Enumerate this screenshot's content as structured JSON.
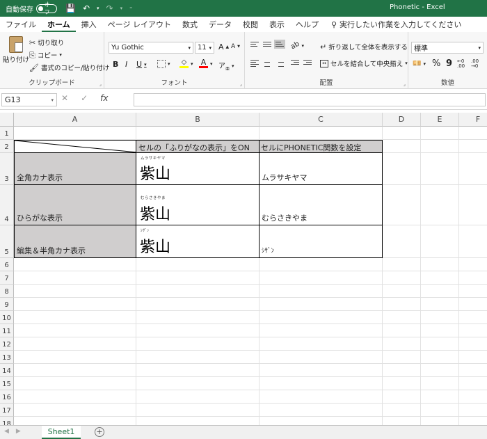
{
  "titlebar": {
    "autosave_label": "自動保存",
    "autosave_state": "オフ",
    "window_title": "Phonetic  -  Excel"
  },
  "tabs": [
    "ファイル",
    "ホーム",
    "挿入",
    "ページ レイアウト",
    "数式",
    "データ",
    "校閲",
    "表示",
    "ヘルプ"
  ],
  "active_tab": "ホーム",
  "tell_me": "実行したい作業を入力してください",
  "ribbon": {
    "clipboard": {
      "paste": "貼り付け",
      "cut": "切り取り",
      "copy": "コピー",
      "format_painter": "書式のコピー/貼り付け",
      "label": "クリップボード"
    },
    "font": {
      "font_name": "Yu Gothic",
      "font_size": "11",
      "label": "フォント",
      "bold": "B",
      "italic": "I",
      "underline": "U",
      "grow": "A",
      "shrink": "A"
    },
    "alignment": {
      "wrap_text": "折り返して全体を表示する",
      "merge_center": "セルを結合して中央揃え",
      "label": "配置"
    },
    "number": {
      "format": "標準",
      "percent": "%",
      "comma": "9",
      "label": "数値"
    }
  },
  "formula_bar": {
    "name_box": "G13",
    "formula": "",
    "cancel": "✕",
    "enter": "✓",
    "fx": "fx"
  },
  "columns": [
    "A",
    "B",
    "C",
    "D",
    "E",
    "F"
  ],
  "rows": [
    "1",
    "2",
    "3",
    "4",
    "5",
    "6",
    "7",
    "8",
    "9",
    "10",
    "11",
    "12",
    "13",
    "14",
    "15",
    "16",
    "17",
    "18"
  ],
  "cells": {
    "B2": "セルの「ふりがなの表示」をON",
    "C2": "セルにPHONETIC関数を設定",
    "A3": "全角カナ表示",
    "A4": "ひらがな表示",
    "A5": "編集＆半角カナ表示",
    "B3_furigana": "ムラサキヤマ",
    "B3": "紫山",
    "B4_furigana": "むらさきやま",
    "B4": "紫山",
    "B5_furigana": "ｼｻﾞﾝ",
    "B5": "紫山",
    "C3": "ムラサキヤマ",
    "C4": "むらさきやま",
    "C5": "ｼｻﾞﾝ"
  },
  "sheet_tabs": [
    "Sheet1"
  ],
  "colors": {
    "excel_green": "#217346",
    "header_gray": "#d0cece"
  }
}
